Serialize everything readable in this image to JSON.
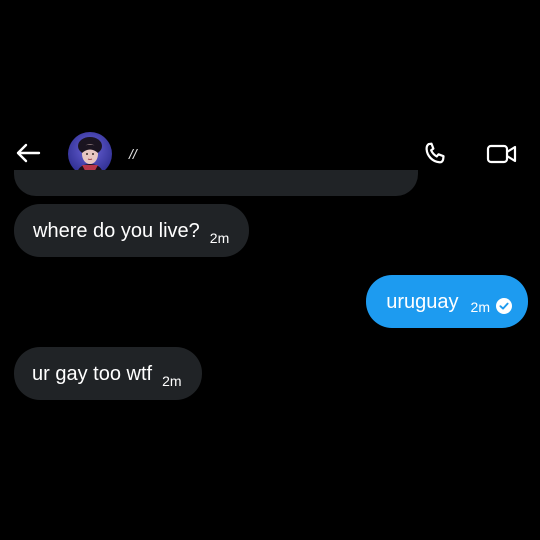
{
  "header": {
    "back_icon": "arrow-left-icon",
    "contact_name": "//",
    "call_icon": "phone-icon",
    "video_icon": "video-camera-icon"
  },
  "messages": [
    {
      "direction": "incoming",
      "text": "where do you live?",
      "time": "2m"
    },
    {
      "direction": "outgoing",
      "text": "uruguay",
      "time": "2m",
      "status_icon": "check-circle-icon"
    },
    {
      "direction": "incoming",
      "text": "ur gay too wtf",
      "time": "2m"
    }
  ],
  "colors": {
    "background": "#000000",
    "incoming_bubble": "#202326",
    "outgoing_bubble": "#1d9bf0",
    "text": "#ffffff"
  }
}
